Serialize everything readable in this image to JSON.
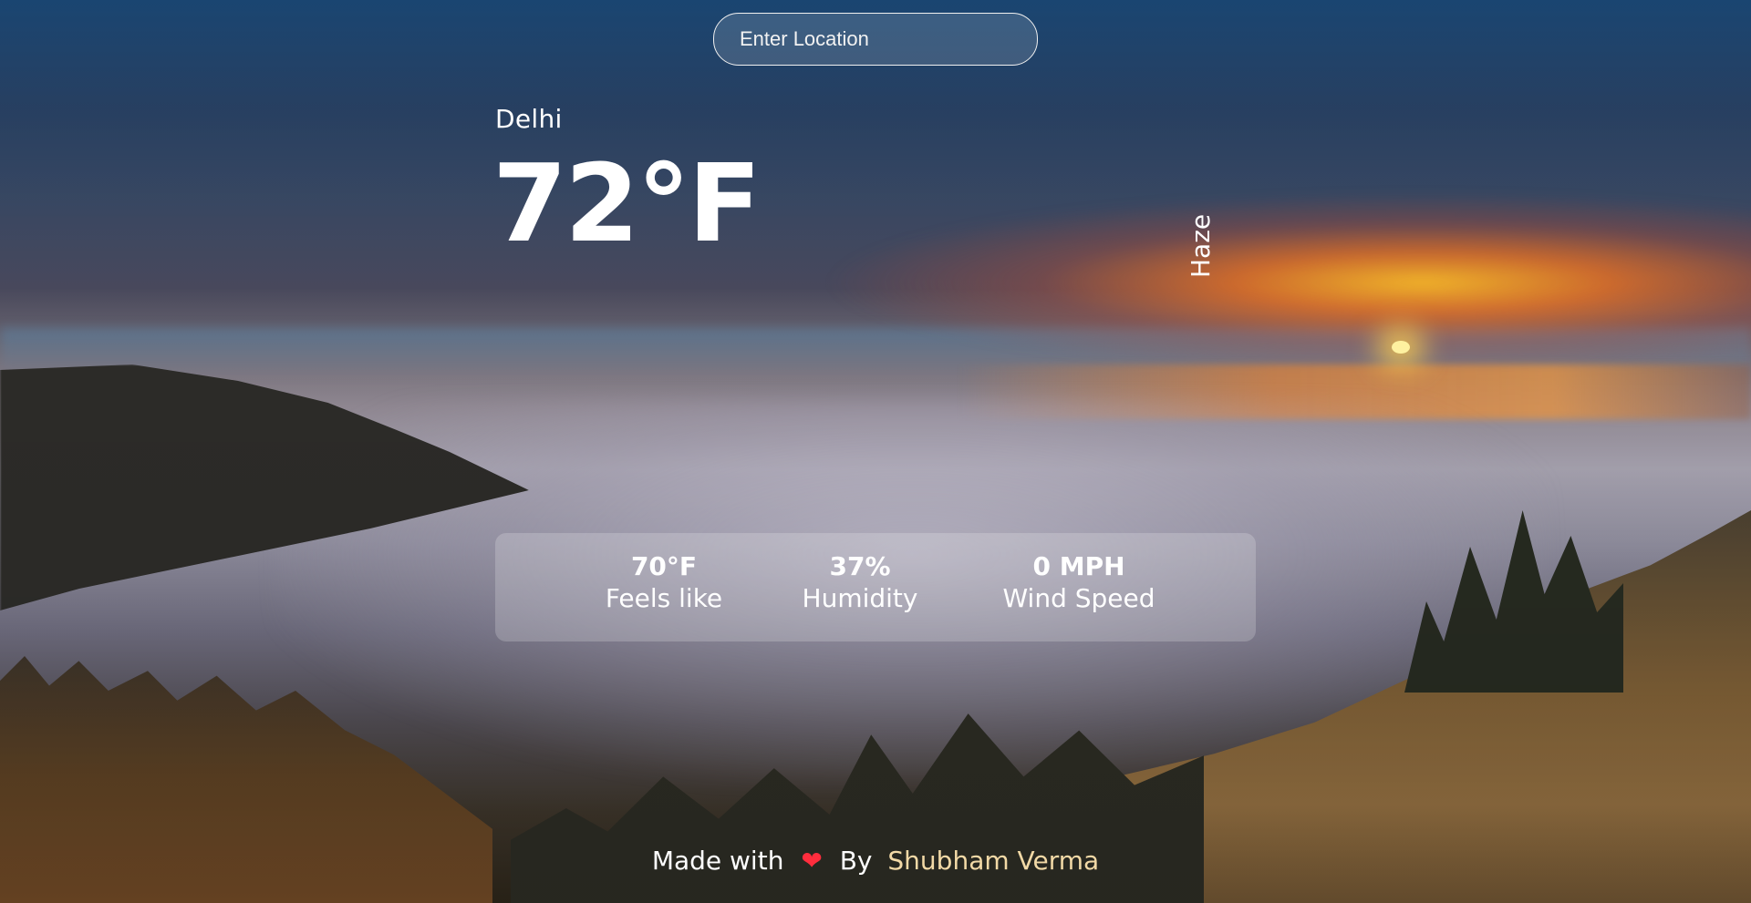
{
  "search": {
    "placeholder": "Enter Location",
    "value": ""
  },
  "weather": {
    "location": "Delhi",
    "temperature": "72°F",
    "condition": "Haze"
  },
  "stats": {
    "feels_like": {
      "value": "70°F",
      "label": "Feels like"
    },
    "humidity": {
      "value": "37%",
      "label": "Humidity"
    },
    "wind_speed": {
      "value": "0 MPH",
      "label": "Wind Speed"
    }
  },
  "footer": {
    "made_with": "Made with",
    "heart_icon": "heart-icon",
    "by": "By",
    "author": "Shubham Verma"
  },
  "colors": {
    "text": "#ffffff",
    "author": "#f2d9a6",
    "heart": "#ff2d3d"
  }
}
